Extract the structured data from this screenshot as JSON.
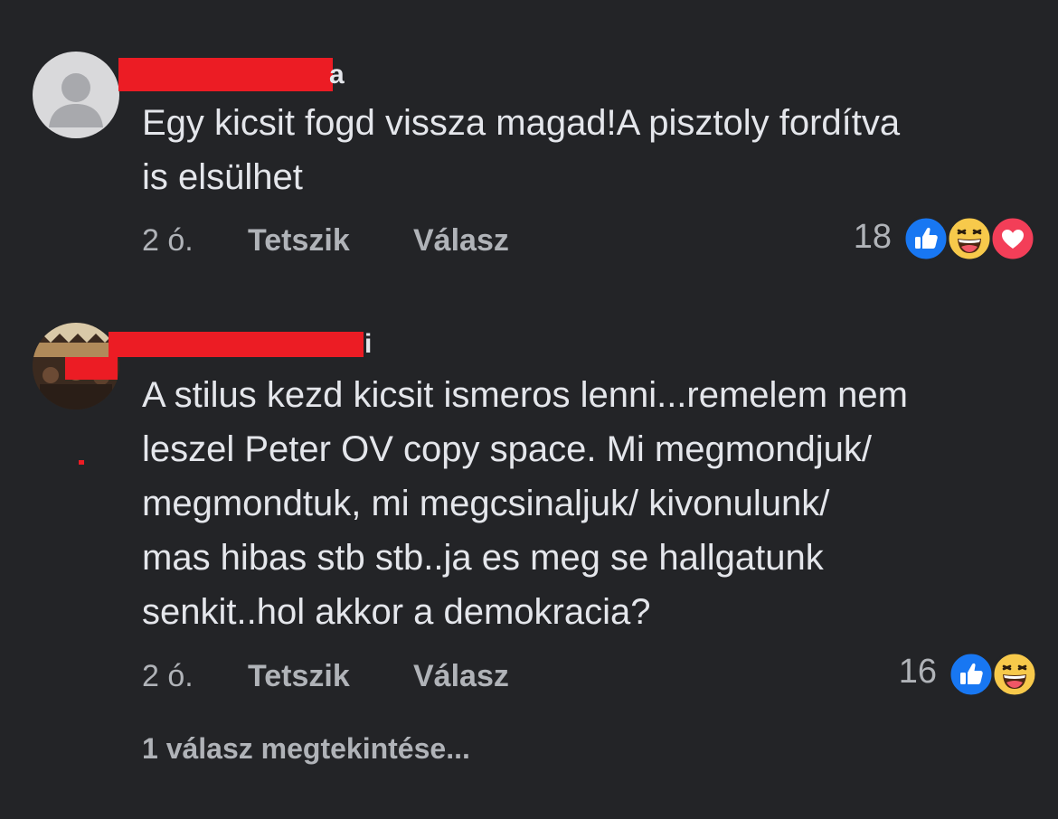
{
  "colors": {
    "background": "#232427",
    "text": "#e4e6eb",
    "secondary_text": "#b0b3b8",
    "redaction": "#ec1c24",
    "like_blue": "#1877f2",
    "love_red": "#f33e58",
    "haha_yellow": "#f7c94b"
  },
  "comments": [
    {
      "author_visible_tail": "a",
      "text": "Egy kicsit fogd vissza magad!A pisztoly fordítva\nis elsülhet",
      "time": "2 ó.",
      "like_label": "Tetszik",
      "reply_label": "Válasz",
      "reaction_count": "18",
      "reactions": [
        "like-icon",
        "haha-icon",
        "love-icon"
      ]
    },
    {
      "author_visible_tail": "i",
      "text": "A stilus kezd kicsit ismeros lenni...remelem nem\nleszel Peter OV copy space. Mi megmondjuk/\nmegmondtuk, mi megcsinaljuk/ kivonulunk/\nmas hibas stb stb..ja es meg se hallgatunk\nsenkit..hol akkor a demokracia?",
      "time": "2 ó.",
      "like_label": "Tetszik",
      "reply_label": "Válasz",
      "reaction_count": "16",
      "reactions": [
        "like-icon",
        "haha-icon"
      ],
      "view_replies": "1 válasz megtekintése..."
    }
  ]
}
